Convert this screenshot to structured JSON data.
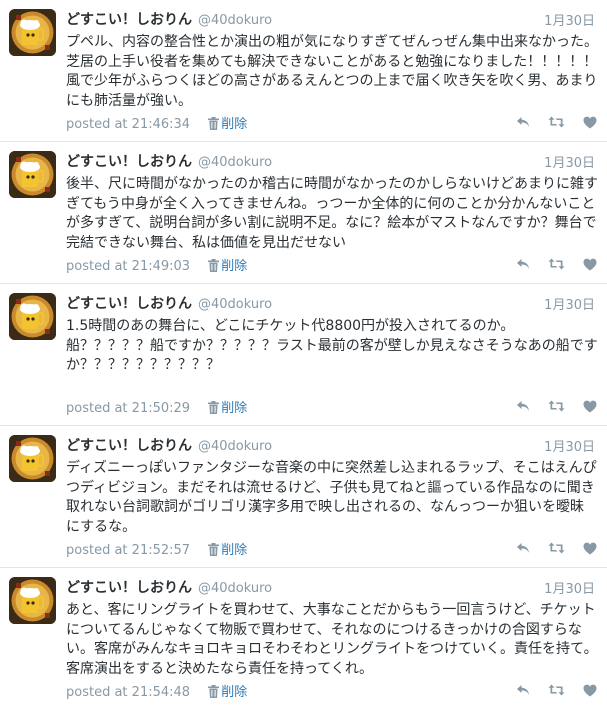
{
  "user": {
    "display_name": "どすこい！しおりん",
    "screen_name": "@40dokuro"
  },
  "labels": {
    "posted_at_prefix": "posted at",
    "delete": "削除"
  },
  "colors": {
    "link": "#2b7bb9",
    "muted": "#8899a6",
    "text": "#292f33",
    "divider": "#e1e8ed"
  },
  "icons": [
    "avatar-image",
    "trash-icon",
    "reply-icon",
    "retweet-icon",
    "favorite-icon"
  ],
  "tweets": [
    {
      "date": "1月30日",
      "text": "プペル、内容の整合性とか演出の粗が気になりすぎてぜんっぜん集中出来なかった。芝居の上手い役者を集めても解決できないことがあると勉強になりました！！！！！風で少年がふらつくほどの高さがあるえんとつの上まで届く吹き矢を吹く男、あまりにも肺活量が強い。",
      "time": "21:46:34"
    },
    {
      "date": "1月30日",
      "text": "後半、尺に時間がなかったのか稽古に時間がなかったのかしらないけどあまりに雑すぎてもう中身が全く入ってきませんね。っつーか全体的に何のことか分かんないことが多すぎて、説明台詞が多い割に説明不足。なに？絵本がマストなんですか？舞台で完結できない舞台、私は価値を見出だせない",
      "time": "21:49:03"
    },
    {
      "date": "1月30日",
      "text": "1.5時間のあの舞台に、どこにチケット代8800円が投入されてるのか。\n船？？？？？船ですか？？？？？ラスト最前の客が壁しか見えなさそうなあの船ですか？？？？？？？？？？",
      "time": "21:50:29"
    },
    {
      "date": "1月30日",
      "text": "ディズニーっぽいファンタジーな音楽の中に突然差し込まれるラップ、そこはえんぴつディビジョン。まだそれは流せるけど、子供も見てねと謳っている作品なのに聞き取れない台詞歌詞がゴリゴリ漢字多用で映し出されるの、なんっつーか狙いを曖昧にするな。",
      "time": "21:52:57"
    },
    {
      "date": "1月30日",
      "text": "あと、客にリングライトを買わせて、大事なことだからもう一回言うけど、チケットについてるんじゃなくて物販で買わせて、それなのにつけるきっかけの合図すらない。客席がみんなキョロキョロそわそわとリングライトをつけていく。責任を持て。客席演出をすると決めたなら責任を持ってくれ。",
      "time": "21:54:48"
    }
  ]
}
